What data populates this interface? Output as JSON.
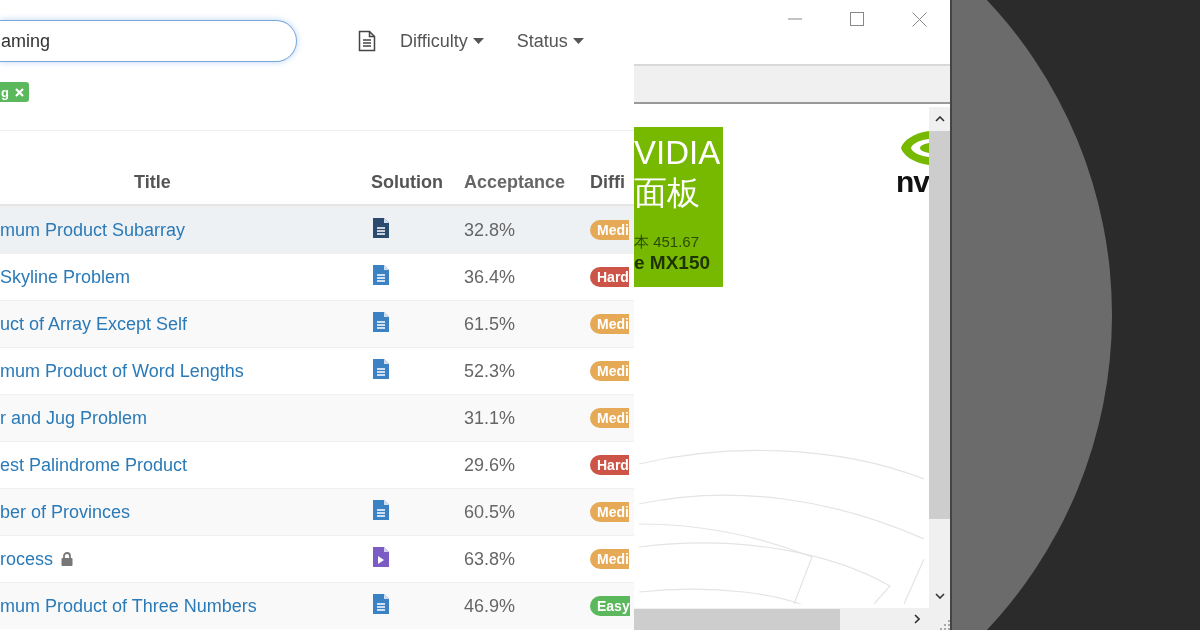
{
  "problem_list": {
    "search": {
      "value": "aming"
    },
    "filters": [
      {
        "label": "Difficulty"
      },
      {
        "label": "Status"
      }
    ],
    "tags": [
      {
        "label": "g"
      }
    ],
    "table": {
      "columns": [
        "Title",
        "Solution",
        "Acceptance",
        "Diffi"
      ],
      "rows": [
        {
          "title": "mum Product Subarray",
          "locked": false,
          "solution": {
            "kind": "article"
          },
          "acceptance": "32.8%",
          "difficulty": {
            "label": "Medi",
            "kind": "medium"
          },
          "selected": true
        },
        {
          "title": "Skyline Problem",
          "locked": false,
          "solution": {
            "kind": "article"
          },
          "acceptance": "36.4%",
          "difficulty": {
            "label": "Hard",
            "kind": "hard"
          },
          "selected": false
        },
        {
          "title": "uct of Array Except Self",
          "locked": false,
          "solution": {
            "kind": "article"
          },
          "acceptance": "61.5%",
          "difficulty": {
            "label": "Medi",
            "kind": "medium"
          },
          "selected": false
        },
        {
          "title": "mum Product of Word Lengths",
          "locked": false,
          "solution": {
            "kind": "article"
          },
          "acceptance": "52.3%",
          "difficulty": {
            "label": "Medi",
            "kind": "medium"
          },
          "selected": false
        },
        {
          "title": "r and Jug Problem",
          "locked": false,
          "solution": {
            "kind": "none"
          },
          "acceptance": "31.1%",
          "difficulty": {
            "label": "Medi",
            "kind": "medium"
          },
          "selected": false
        },
        {
          "title": "est Palindrome Product",
          "locked": false,
          "solution": {
            "kind": "none"
          },
          "acceptance": "29.6%",
          "difficulty": {
            "label": "Hard",
            "kind": "hard"
          },
          "selected": false
        },
        {
          "title": "ber of Provinces",
          "locked": false,
          "solution": {
            "kind": "article"
          },
          "acceptance": "60.5%",
          "difficulty": {
            "label": "Medi",
            "kind": "medium"
          },
          "selected": false
        },
        {
          "title": "rocess",
          "locked": true,
          "solution": {
            "kind": "video"
          },
          "acceptance": "63.8%",
          "difficulty": {
            "label": "Medi",
            "kind": "medium"
          },
          "selected": false
        },
        {
          "title": "mum Product of Three Numbers",
          "locked": false,
          "solution": {
            "kind": "article"
          },
          "acceptance": "46.9%",
          "difficulty": {
            "label": "Easy",
            "kind": "easy"
          },
          "selected": false
        }
      ]
    }
  },
  "control_panel_window": {
    "banner_lines": [
      {
        "text": "VIDIA",
        "kind": "title"
      },
      {
        "text": "面板",
        "kind": "title"
      },
      {
        "text": "本 451.67",
        "kind": "version"
      },
      {
        "text": "e MX150",
        "kind": "model"
      }
    ],
    "logo_text": "nv"
  }
}
